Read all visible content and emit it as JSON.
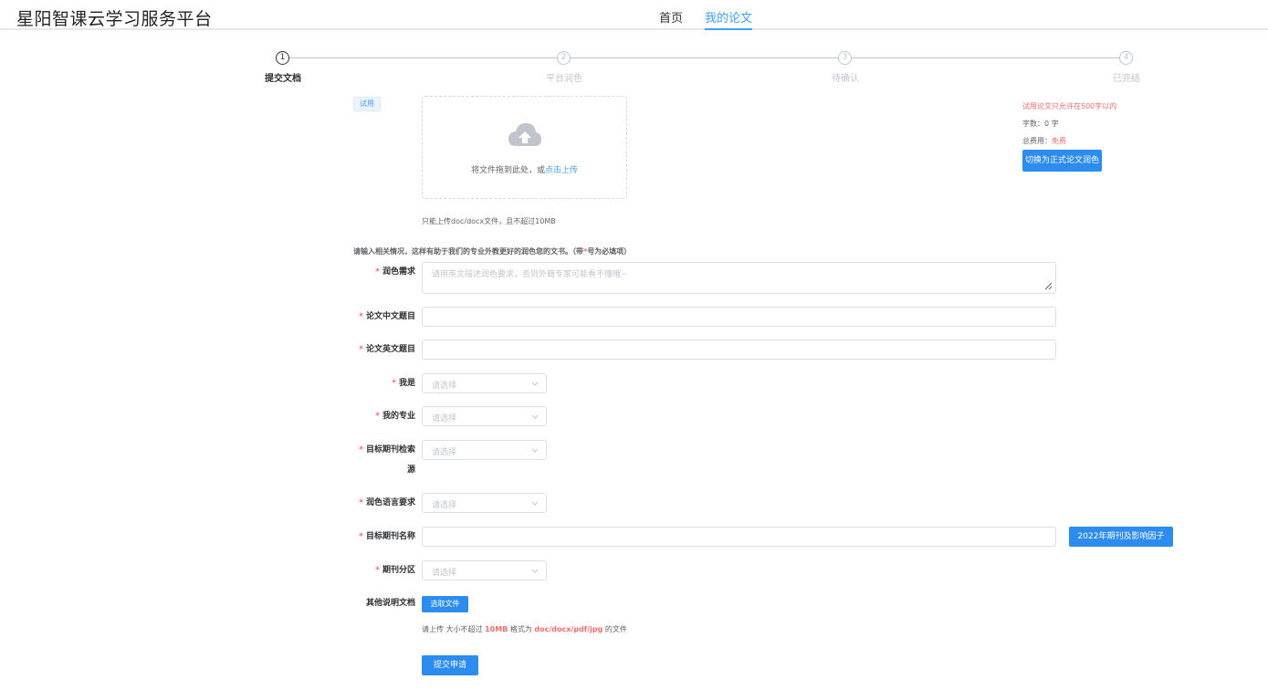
{
  "app": {
    "title": "星阳智课云学习服务平台"
  },
  "nav": {
    "items": [
      {
        "label": "首页"
      },
      {
        "label": "我的论文"
      }
    ]
  },
  "steps": [
    {
      "num": "1",
      "label": "提交文档"
    },
    {
      "num": "2",
      "label": "平台润色"
    },
    {
      "num": "3",
      "label": "待确认"
    },
    {
      "num": "4",
      "label": "已完结"
    }
  ],
  "upload": {
    "tag": "试用",
    "text_prefix": "将文件拖到此处，或",
    "text_link": "点击上传",
    "tip": "只能上传doc/docx文件，且不超过10MB"
  },
  "side": {
    "warning": "试用论文只允许在500字以内",
    "word_label": "字数：",
    "word_count": "0",
    "word_unit": "字",
    "fee_label": "总费用：",
    "fee_value": "免费",
    "switch_button": "切换为正式论文润色"
  },
  "intro": {
    "prefix": "请输入相关情况，这样有助于我们的专业外教更好的润色您的文书。（带",
    "star": "*",
    "suffix": "号为必填项）"
  },
  "form": {
    "star": "*",
    "polish_label": "润色需求",
    "polish_placeholder": "请用英文描述润色要求，否则外籍专家可能看不懂哦~",
    "cn_title_label": "论文中文题目",
    "en_title_label": "论文英文题目",
    "identity_label": "我是",
    "major_label": "我的专业",
    "index_label_line1": "目标期刊检索",
    "index_label_line2": "源",
    "language_label": "润色语言要求",
    "journal_label": "目标期刊名称",
    "journal_button": "2022年期刊及影响因子",
    "partition_label": "期刊分区",
    "select_placeholder": "请选择",
    "other_label": "其他说明文档",
    "pick_button": "选取文件",
    "file_tip_prefix": "请上传 大小不超过",
    "file_tip_size": "10MB",
    "file_tip_mid": "格式为",
    "file_tip_formats": "doc/docx/pdf/jpg",
    "file_tip_suffix": "的文件",
    "submit_button": "提交申请"
  },
  "colors": {
    "primary": "#2d8cf0",
    "link": "#409eff",
    "danger": "#f56c6c"
  }
}
